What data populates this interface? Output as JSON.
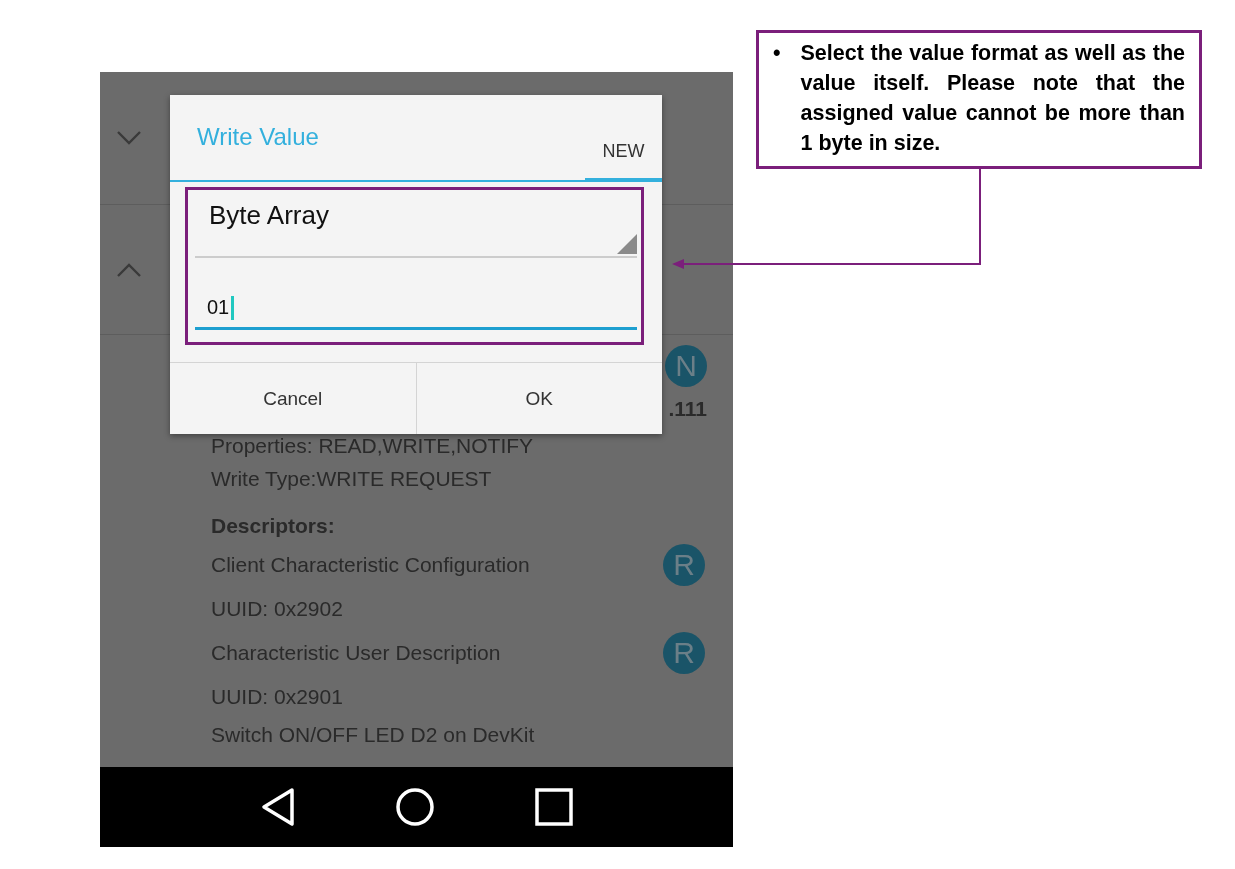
{
  "background": {
    "chevrons": [
      {
        "expanded": false
      },
      {
        "expanded": true
      }
    ],
    "notify_badge": "N",
    "fragment": ".111",
    "properties": "Properties: READ,WRITE,NOTIFY",
    "write_type": "Write Type:WRITE REQUEST",
    "descriptors_heading": "Descriptors:",
    "descriptors": [
      {
        "name": "Client Characteristic Configuration",
        "uuid": "UUID: 0x2902",
        "badge": "R"
      },
      {
        "name": "Characteristic User Description",
        "uuid": "UUID: 0x2901",
        "badge": "R"
      }
    ],
    "description": "Switch ON/OFF LED D2 on DevKit"
  },
  "dialog": {
    "title": "Write Value",
    "tabs": [
      {
        "label": "NEW",
        "selected": true
      }
    ],
    "format": "Byte Array",
    "value": "01",
    "buttons": [
      "Cancel",
      "OK"
    ]
  },
  "annotation": {
    "bullet": "•",
    "text": "Select the value format as well as the value itself. Please note that the assigned value cannot be more than 1 byte in size."
  }
}
